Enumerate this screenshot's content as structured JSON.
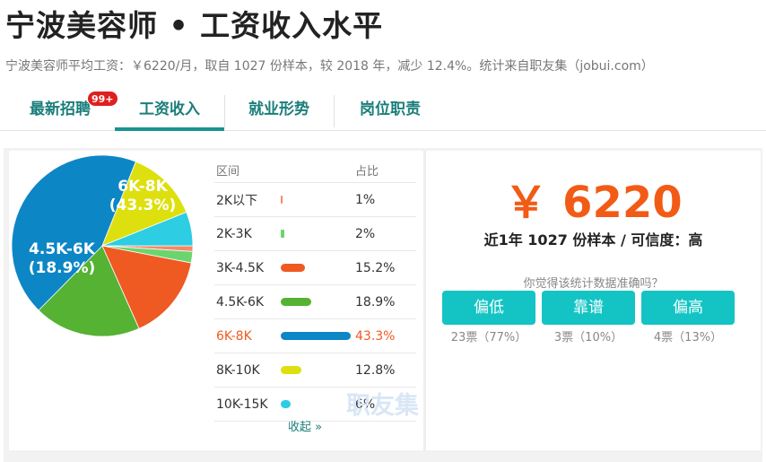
{
  "header": {
    "title": "宁波美容师 • 工资收入水平",
    "subtitle": "宁波美容师平均工资：￥6220/月，取自 1027 份样本，较 2018 年，减少 12.4%。统计来自职友集（jobui.com）"
  },
  "tabs": [
    {
      "label": "最新招聘",
      "badge": "99+"
    },
    {
      "label": "工资收入"
    },
    {
      "label": "就业形势"
    },
    {
      "label": "岗位职责"
    }
  ],
  "chart_data": {
    "type": "pie",
    "categories": [
      "2K以下",
      "2K-3K",
      "3K-4.5K",
      "4.5K-6K",
      "6K-8K",
      "8K-10K",
      "10K-15K"
    ],
    "values": [
      1,
      2,
      15.2,
      18.9,
      43.3,
      12.8,
      6
    ],
    "colors": [
      "#f38a6a",
      "#6cd46f",
      "#ee5a22",
      "#55b233",
      "#0d86c6",
      "#dde00e",
      "#2dcde3"
    ],
    "slice_labels": [
      {
        "name": "6K-8K",
        "pct": "(43.3%)"
      },
      {
        "name": "4.5K-6K",
        "pct": "(18.9%)"
      }
    ],
    "highlight_index": 4
  },
  "table": {
    "header_range": "区间",
    "header_pct": "占比",
    "rows": [
      {
        "range": "2K以下",
        "pct": "1%"
      },
      {
        "range": "2K-3K",
        "pct": "2%"
      },
      {
        "range": "3K-4.5K",
        "pct": "15.2%"
      },
      {
        "range": "4.5K-6K",
        "pct": "18.9%"
      },
      {
        "range": "6K-8K",
        "pct": "43.3%"
      },
      {
        "range": "8K-10K",
        "pct": "12.8%"
      },
      {
        "range": "10K-15K",
        "pct": "6%"
      }
    ],
    "collapse_label": "收起 »"
  },
  "watermark": "职友集",
  "summary": {
    "salary": "￥ 6220",
    "stats": "近1年 1027 份样本 / 可信度：高",
    "question": "你觉得该统计数据准确吗？",
    "votes": [
      {
        "label": "偏低",
        "count": "23票（77%）"
      },
      {
        "label": "靠谱",
        "count": "3票（10%）"
      },
      {
        "label": "偏高",
        "count": "4票（13%）"
      }
    ]
  }
}
